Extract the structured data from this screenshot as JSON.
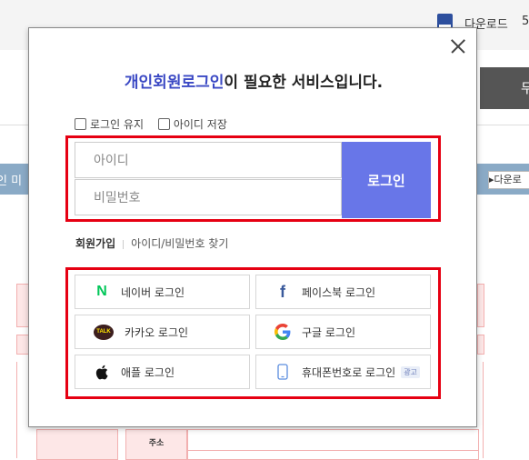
{
  "background": {
    "download_label": "다운로드",
    "download_count": "5",
    "dark_button_label": "무",
    "left_bar_text": "인 미",
    "download_button_label": "다운로",
    "address_label": "주소"
  },
  "modal": {
    "title_highlight": "개인회원로그인",
    "title_rest": "이 필요한 서비스입니다.",
    "options": {
      "keep_login": "로그인 유지",
      "save_id": "아이디 저장"
    },
    "id_placeholder": "아이디",
    "password_placeholder": "비밀번호",
    "login_button": "로그인",
    "links": {
      "join": "회원가입",
      "find": "아이디/비밀번호 찾기"
    },
    "social": {
      "naver": "네이버 로그인",
      "facebook": "페이스북 로그인",
      "kakao": "카카오 로그인",
      "kakao_icon_text": "TALK",
      "google": "구글 로그인",
      "apple": "애플 로그인",
      "phone": "휴대폰번호로 로그인",
      "ad_badge": "광고"
    }
  },
  "colors": {
    "accent": "#3b49c4",
    "login_button_bg": "#6876e8",
    "highlight_frame": "#e60012",
    "naver_green": "#03c75a",
    "facebook_blue": "#3a5a9c"
  },
  "icons": [
    "close-icon",
    "naver-icon",
    "facebook-icon",
    "kakao-icon",
    "google-icon",
    "apple-icon",
    "phone-icon",
    "document-icon"
  ]
}
